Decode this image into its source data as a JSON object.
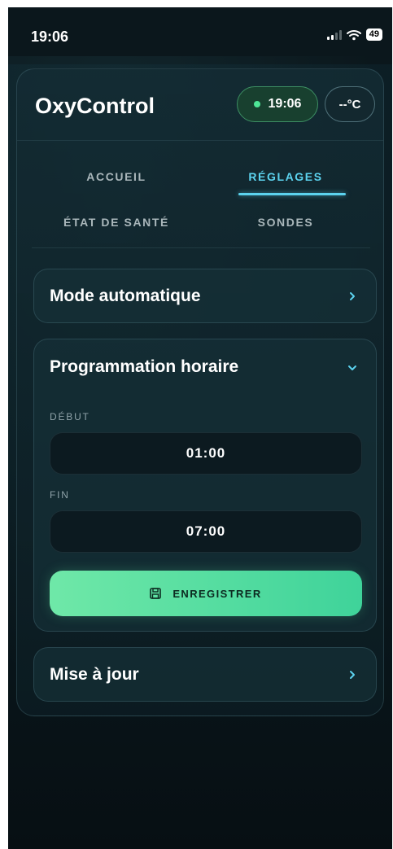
{
  "status_bar": {
    "time": "19:06",
    "battery": "49"
  },
  "header": {
    "title": "OxyControl",
    "time_badge": "19:06",
    "temp_badge": "--°C"
  },
  "tabs": [
    {
      "label": "ACCUEIL",
      "active": false
    },
    {
      "label": "RÉGLAGES",
      "active": true
    },
    {
      "label": "ÉTAT DE SANTÉ",
      "active": false
    },
    {
      "label": "SONDES",
      "active": false
    }
  ],
  "sections": {
    "auto_mode": {
      "title": "Mode automatique"
    },
    "schedule": {
      "title": "Programmation horaire",
      "start_label": "DÉBUT",
      "start_value": "01:00",
      "end_label": "FIN",
      "end_value": "07:00",
      "save_label": "ENREGISTRER"
    },
    "update": {
      "title": "Mise à jour"
    }
  },
  "colors": {
    "accent": "#5cd3ef",
    "success": "#4ee596",
    "button": "#4fdc9f",
    "background": "#0d1f26"
  },
  "icons": {
    "chevron_right": "chevron-right-icon",
    "chevron_down": "chevron-down-icon",
    "save": "floppy-disk-icon"
  }
}
